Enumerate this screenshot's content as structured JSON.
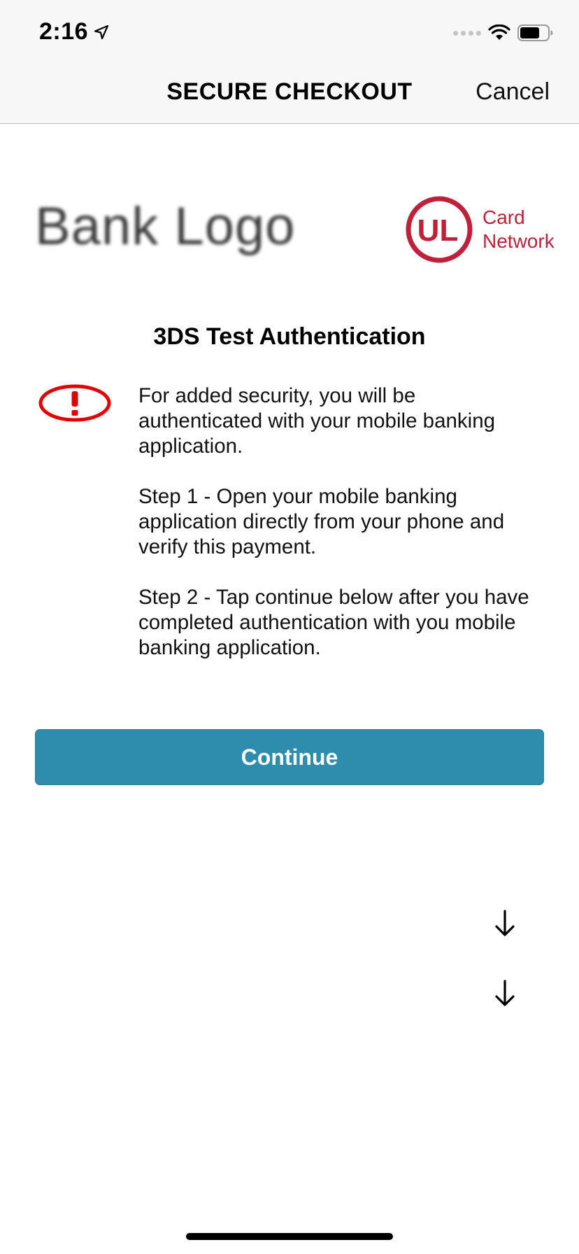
{
  "status_bar": {
    "time": "2:16",
    "icons": [
      "location-arrow-icon",
      "signal-dots-icon",
      "wifi-icon",
      "battery-icon"
    ]
  },
  "nav": {
    "title": "SECURE CHECKOUT",
    "cancel_label": "Cancel"
  },
  "logos": {
    "bank": "Bank Logo",
    "network_mark": "UL",
    "network_line1": "Card",
    "network_line2": "Network",
    "network_color": "#c0213a"
  },
  "auth": {
    "title": "3DS Test Authentication",
    "alert_icon": "exclamation-alert-icon",
    "paragraphs": [
      "For added security, you will be authenticated with your mobile banking application.",
      "Step 1 - Open your mobile banking application directly from your phone and verify this payment.",
      "Step 2 - Tap continue below after you have completed authentication with you mobile banking application."
    ]
  },
  "continue_button": {
    "label": "Continue",
    "color": "#2e8dac"
  },
  "scroll_arrows": [
    "down-arrow-icon",
    "down-arrow-icon"
  ]
}
